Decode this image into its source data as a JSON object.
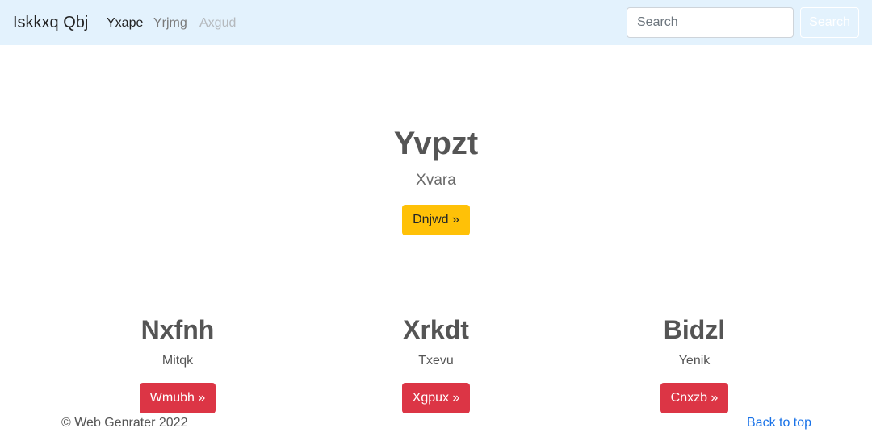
{
  "navbar": {
    "brand": "Iskkxq Qbj",
    "links": [
      {
        "label": "Yxape",
        "state": "active"
      },
      {
        "label": "Yrjmg",
        "state": "normal"
      },
      {
        "label": "Axgud",
        "state": "disabled"
      }
    ],
    "search_placeholder": "Search",
    "search_button": "Search",
    "background_color": "#e3f2fd"
  },
  "hero": {
    "title": "Yvpzt",
    "subtitle": "Xvara",
    "button": "Dnjwd »",
    "button_color": "#ffc107"
  },
  "columns": [
    {
      "title": "Nxfnh",
      "text": "Mitqk",
      "button": "Wmubh »"
    },
    {
      "title": "Xrkdt",
      "text": "Txevu",
      "button": "Xgpux »"
    },
    {
      "title": "Bidzl",
      "text": "Yenik",
      "button": "Cnxzb »"
    }
  ],
  "column_button_color": "#dc3545",
  "footer": {
    "copyright": "© Web Genrater 2022",
    "back_to_top": "Back to top"
  }
}
